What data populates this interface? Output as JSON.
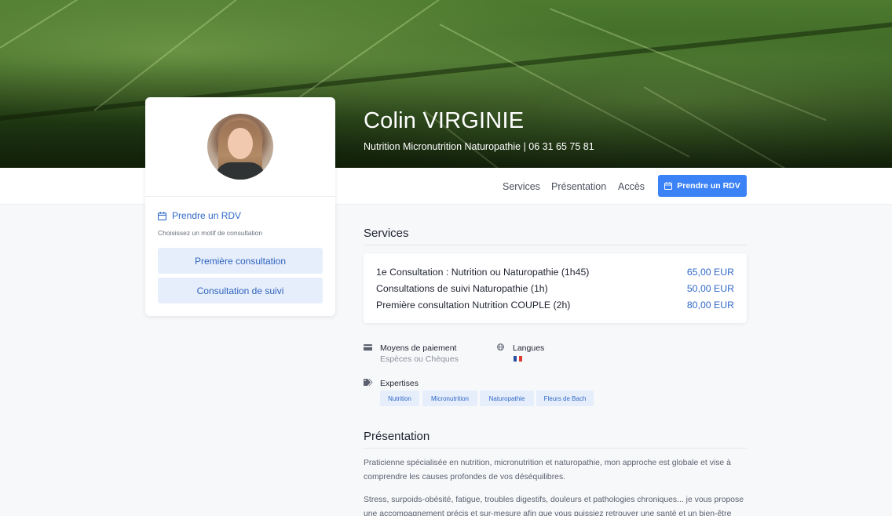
{
  "hero": {
    "name": "Colin VIRGINIE",
    "subtitle": "Nutrition Micronutrition Naturopathie | 06 31 65 75 81"
  },
  "nav": {
    "links": [
      "Services",
      "Présentation",
      "Accès"
    ],
    "rdv_button": "Prendre un RDV"
  },
  "sidebar": {
    "rdv_link": "Prendre un RDV",
    "hint": "Choisissez un motif de consultation",
    "motifs": [
      "Première consultation",
      "Consultation de suivi"
    ]
  },
  "services": {
    "title": "Services",
    "items": [
      {
        "name": "1e Consultation : Nutrition ou Naturopathie (1h45)",
        "price": "65,00 EUR"
      },
      {
        "name": "Consultations de suivi Naturopathie (1h)",
        "price": "50,00 EUR"
      },
      {
        "name": "Première consultation Nutrition COUPLE (2h)",
        "price": "80,00 EUR"
      }
    ]
  },
  "payment": {
    "label": "Moyens de paiement",
    "value": "Espèces ou Chèques"
  },
  "languages": {
    "label": "Langues",
    "flag": "french-flag-icon"
  },
  "expertises": {
    "label": "Expertises",
    "tags": [
      "Nutrition",
      "Micronutrition",
      "Naturopathie",
      "Fleurs de Bach"
    ]
  },
  "presentation": {
    "title": "Présentation",
    "paragraphs": [
      "Praticienne spécialisée en nutrition, micronutrition et naturopathie, mon approche est globale et vise à comprendre les causes profondes de vos déséquilibres.",
      "Stress, surpoids-obésité, fatigue, troubles digestifs, douleurs et pathologies chroniques... je vous propose une accompagnement précis et sur-mesure afin que vous puissiez retrouver une santé et un bien-être durable."
    ]
  },
  "colors": {
    "accent": "#3b82f6",
    "link": "#3168c8",
    "tag_bg": "#e6eefb"
  }
}
